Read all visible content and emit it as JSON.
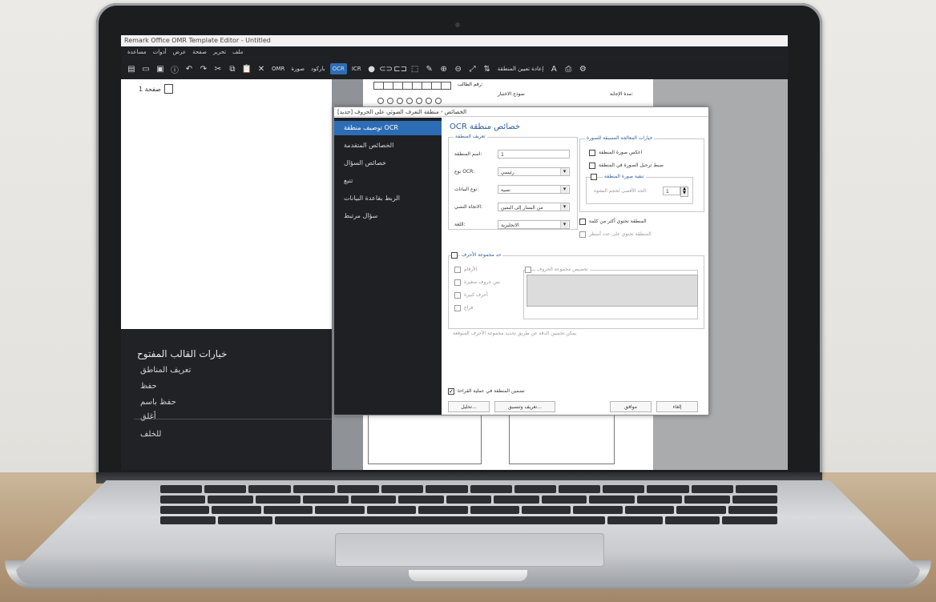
{
  "window": {
    "title": "Remark Office OMR Template Editor - Untitled"
  },
  "menu": [
    "مساعدة",
    "أدوات",
    "عرض",
    "صفحة",
    "تحرير",
    "ملف"
  ],
  "toolbar": {
    "labels": [
      "OMR",
      "صورة",
      "باركود",
      "OCR",
      "ICR",
      "إعادة تعيين المنطقة"
    ],
    "active": "OCR"
  },
  "tree": {
    "page_label": "صفحة 1"
  },
  "template_options": {
    "title": "خيارات القالب المفتوح",
    "items": [
      "تعريف المناطق",
      "حفظ",
      "حفظ باسم",
      "أغلق"
    ],
    "back": "للخلف"
  },
  "sheet": {
    "student_number": "رقم الطالب:",
    "test_form": "نموذج الاختبار",
    "answer_period": "مدة الإجابة:"
  },
  "dialog": {
    "title": "الخصائص - منطقة التعرف الضوئي على الحروف [جديد]",
    "heading": "OCR خصائص منطقة",
    "sidebar": [
      {
        "label": "توصيف منطقة OCR",
        "active": true
      },
      {
        "label": "الخصائص المتقدمة",
        "active": false
      },
      {
        "label": "خصائص السؤال",
        "active": false
      },
      {
        "label": "تنبع",
        "active": false
      },
      {
        "label": "الربط بقاعدة البيانات",
        "active": false
      },
      {
        "label": "سؤال مرتبط",
        "active": false
      }
    ],
    "region_group": "تعريف المنطقة",
    "region_name_label": "اسم المنطقة:",
    "region_name_value": "1",
    "ocr_type_label": "نوع OCR:",
    "ocr_type_value": "رئيسي",
    "data_type_label": "نوع البيانات:",
    "data_type_value": "نصية",
    "text_direction_label": "الاتجاه النصي:",
    "text_direction_value": "من اليسار إلى اليمين",
    "language_label": "اللغة:",
    "language_value": "الانجليزية",
    "image_group": "خيارات المعالجة المسبقة للصورة",
    "invert_image": "اعكس صورة المنطقة",
    "deskew_image": "ضبط ترحيل الصورة في المنطقة",
    "clean_group": "تنقية صورة المنطقة",
    "max_size_label": "الحد الأقصى لحجم التشوه:",
    "max_size_value": "1",
    "multi_word": "المنطقة تحتوي أكثر من كلمة",
    "multi_line": "المنطقة تحتوي على عدد أسطر",
    "charset_group": "حد مجموعة الأحرف",
    "charset_items": [
      "الأرقام",
      "نص حروف صغيرة",
      "أحرف كبيرة",
      "فراغ"
    ],
    "custom_charset": "تخصيص مجموعة الحروف",
    "hint": "يمكن تحسين الدقة عن طريق تحديد مجموعة الأحرف المتوقعة",
    "include_in_read": "تضمين المنطقة في عملية القراءة",
    "buttons": {
      "analyze": "تحليل...",
      "define": "تعريف وتنسيق...",
      "ok": "موافق",
      "cancel": "إلغاء"
    }
  }
}
